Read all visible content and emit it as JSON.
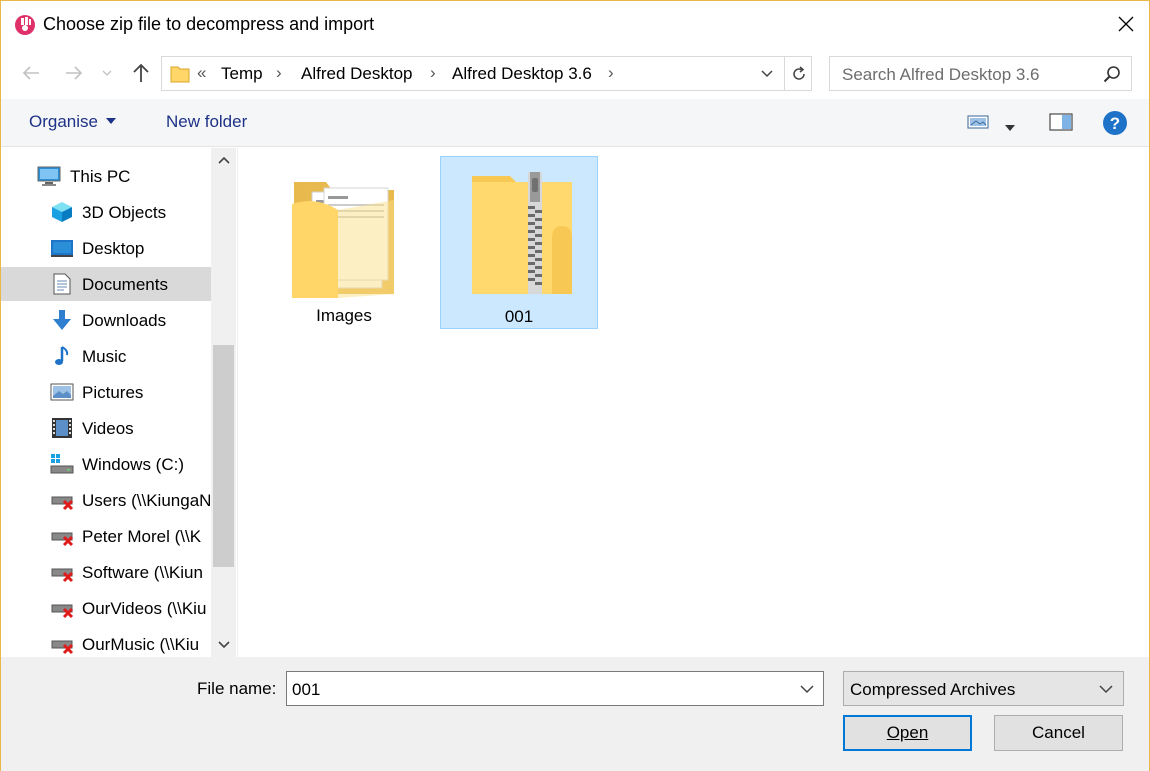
{
  "window": {
    "title": "Choose zip file to decompress and import",
    "accent_border": "#e8b84a"
  },
  "nav": {
    "back_icon": "arrow-left-icon",
    "forward_icon": "arrow-right-icon",
    "recent_icon": "chevron-down-icon",
    "up_icon": "arrow-up-icon",
    "breadcrumb": {
      "overflow": "«",
      "items": [
        "Temp",
        "Alfred Desktop",
        "Alfred Desktop 3.6"
      ],
      "separator": "›"
    },
    "search_placeholder": "Search Alfred Desktop 3.6"
  },
  "toolbar": {
    "organise_label": "Organise",
    "new_folder_label": "New folder",
    "view_icon": "view-icon",
    "preview_pane_icon": "preview-pane-icon",
    "help_icon": "help-icon",
    "help_color": "#1e72c8"
  },
  "sidebar": {
    "items": [
      {
        "label": "This PC",
        "icon": "pc-icon",
        "selected": false
      },
      {
        "label": "3D Objects",
        "icon": "cube-icon",
        "selected": false
      },
      {
        "label": "Desktop",
        "icon": "desktop-icon",
        "selected": false
      },
      {
        "label": "Documents",
        "icon": "document-icon",
        "selected": true
      },
      {
        "label": "Downloads",
        "icon": "download-icon",
        "selected": false
      },
      {
        "label": "Music",
        "icon": "music-icon",
        "selected": false
      },
      {
        "label": "Pictures",
        "icon": "pictures-icon",
        "selected": false
      },
      {
        "label": "Videos",
        "icon": "videos-icon",
        "selected": false
      },
      {
        "label": "Windows (C:)",
        "icon": "drive-icon",
        "selected": false
      },
      {
        "label": "Users (\\\\KiungaN",
        "icon": "network-drive-disconnected-icon",
        "selected": false
      },
      {
        "label": "Peter Morel (\\\\K",
        "icon": "network-drive-disconnected-icon",
        "selected": false
      },
      {
        "label": "Software (\\\\Kiun",
        "icon": "network-drive-disconnected-icon",
        "selected": false
      },
      {
        "label": "OurVideos (\\\\Kiu",
        "icon": "network-drive-disconnected-icon",
        "selected": false
      },
      {
        "label": "OurMusic (\\\\Kiu",
        "icon": "network-drive-disconnected-icon",
        "selected": false
      }
    ]
  },
  "files": [
    {
      "name": "Images",
      "type": "folder",
      "selected": false
    },
    {
      "name": "001",
      "type": "zip",
      "selected": true
    }
  ],
  "bottom": {
    "file_name_label": "File name:",
    "file_name_value": "001",
    "file_type_value": "Compressed Archives",
    "open_label": "Open",
    "cancel_label": "Cancel"
  }
}
